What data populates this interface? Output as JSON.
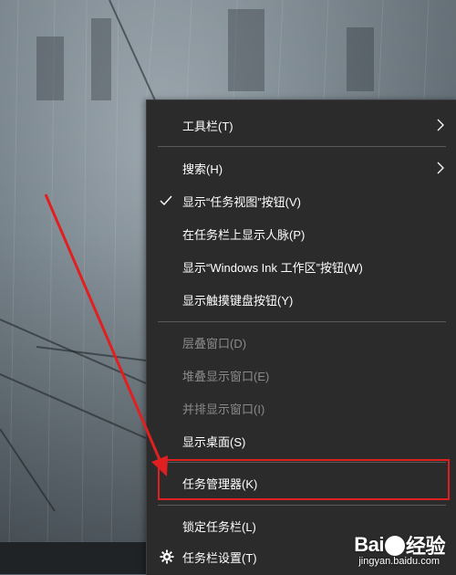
{
  "menu": {
    "items": [
      {
        "label": "工具栏(T)",
        "has_submenu": true
      },
      {
        "label": "搜索(H)",
        "has_submenu": true
      },
      {
        "label": "显示“任务视图”按钮(V)",
        "checked": true
      },
      {
        "label": "在任务栏上显示人脉(P)"
      },
      {
        "label": "显示“Windows Ink 工作区”按钮(W)"
      },
      {
        "label": "显示触摸键盘按钮(Y)"
      },
      {
        "label": "层叠窗口(D)",
        "disabled": true
      },
      {
        "label": "堆叠显示窗口(E)",
        "disabled": true
      },
      {
        "label": "并排显示窗口(I)",
        "disabled": true
      },
      {
        "label": "显示桌面(S)"
      },
      {
        "label": "任务管理器(K)",
        "highlighted": true
      },
      {
        "label": "锁定任务栏(L)"
      },
      {
        "label": "任务栏设置(T)",
        "icon": "gear-icon"
      }
    ]
  },
  "annotation": {
    "color": "#e02020"
  },
  "watermark": {
    "logo": "Bai  经验",
    "logo_left": "Bai",
    "logo_right": "经验",
    "url": "jingyan.baidu.com"
  },
  "colors": {
    "menu_bg": "#2b2b2b",
    "menu_text": "#ffffff",
    "disabled_text": "#8a8a8a",
    "separator": "#5a5a5a"
  }
}
